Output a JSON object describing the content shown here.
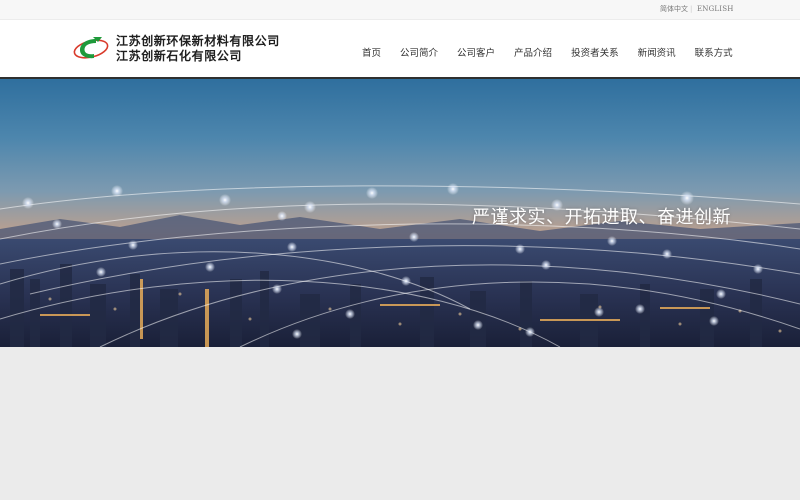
{
  "topbar": {
    "lang_zh": "简体中文",
    "separator": "|",
    "lang_en": "ENGLISH"
  },
  "header": {
    "company_line1": "江苏创新环保新材料有限公司",
    "company_line2": "江苏创新石化有限公司",
    "logo_icon": "company-logo-icon",
    "brand_colors": {
      "green": "#1f9a3b",
      "red": "#d93a2b"
    }
  },
  "nav": {
    "items": [
      {
        "label": "首页"
      },
      {
        "label": "公司简介"
      },
      {
        "label": "公司客户"
      },
      {
        "label": "产品介绍"
      },
      {
        "label": "投资者关系"
      },
      {
        "label": "新闻资讯"
      },
      {
        "label": "联系方式"
      }
    ]
  },
  "hero": {
    "slogan": "严谨求实、开拓进取、奋进创新",
    "image": "city-night-network-banner"
  }
}
